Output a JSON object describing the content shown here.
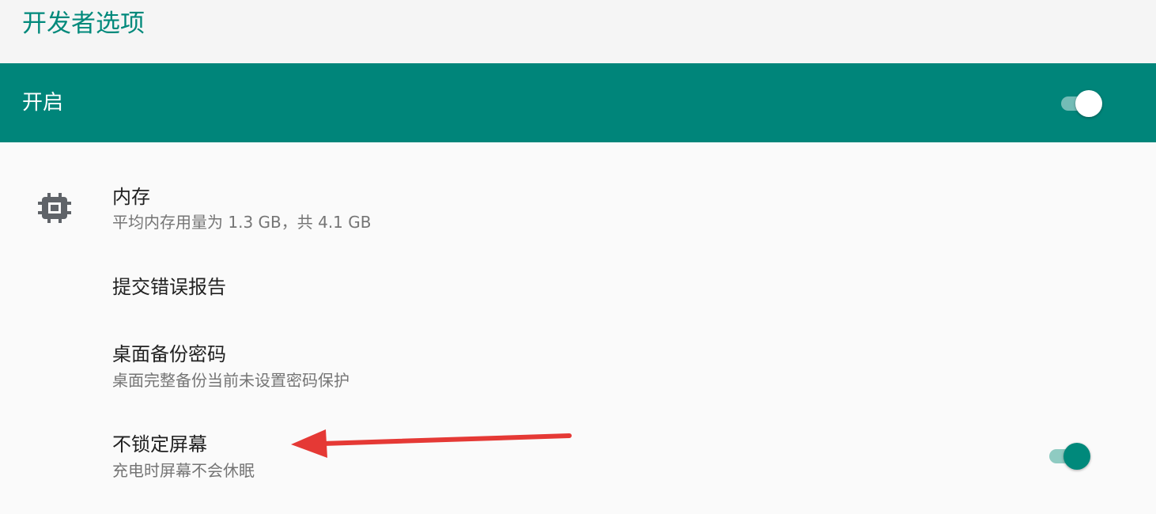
{
  "header": {
    "title": "开发者选项"
  },
  "master_toggle": {
    "label": "开启",
    "checked": true
  },
  "preferences": {
    "memory": {
      "icon": "memory-chip-icon",
      "title": "内存",
      "summary": "平均内存用量为 1.3 GB，共 4.1 GB"
    },
    "bug_report": {
      "title": "提交错误报告"
    },
    "backup_password": {
      "title": "桌面备份密码",
      "summary": "桌面完整备份当前未设置密码保护"
    },
    "stay_awake": {
      "title": "不锁定屏幕",
      "summary": "充电时屏幕不会休眠",
      "checked": true
    }
  },
  "colors": {
    "accent": "#00897b",
    "master_bar": "#00857a",
    "annotation_arrow": "#e53935"
  }
}
